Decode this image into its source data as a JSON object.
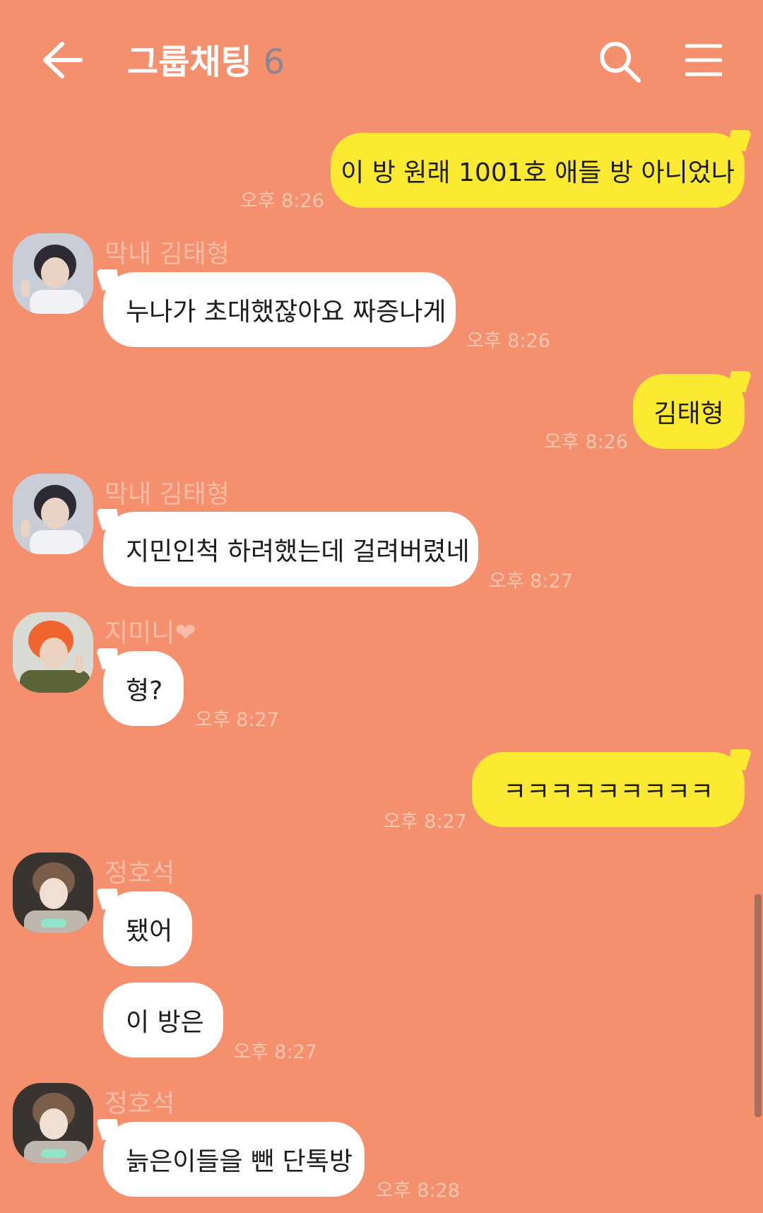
{
  "header": {
    "title": "그룹채팅",
    "member_count": "6"
  },
  "messages": [
    {
      "type": "out",
      "text": "이 방 원래 1001호 애들 방 아니었나",
      "time": "오후 8:26"
    },
    {
      "type": "in",
      "sender": "막내 김태형",
      "text": "누나가 초대했잖아요 짜증나게",
      "time": "오후 8:26"
    },
    {
      "type": "out",
      "text": "김태형",
      "time": "오후 8:26"
    },
    {
      "type": "in",
      "sender": "막내 김태형",
      "text": "지민인척 하려했는데 걸려버렸네",
      "time": "오후 8:27"
    },
    {
      "type": "in",
      "sender": "지미니❤",
      "text": "형?",
      "time": "오후 8:27"
    },
    {
      "type": "out",
      "text": "ㅋㅋㅋㅋㅋㅋㅋㅋㅋ",
      "time": "오후 8:27"
    },
    {
      "type": "in",
      "sender": "정호석",
      "text": "됐어",
      "text2": "이 방은",
      "time": "오후 8:27"
    },
    {
      "type": "in",
      "sender": "정호석",
      "text": "늙은이들을 뺀 단톡방",
      "time": "오후 8:28"
    }
  ]
}
